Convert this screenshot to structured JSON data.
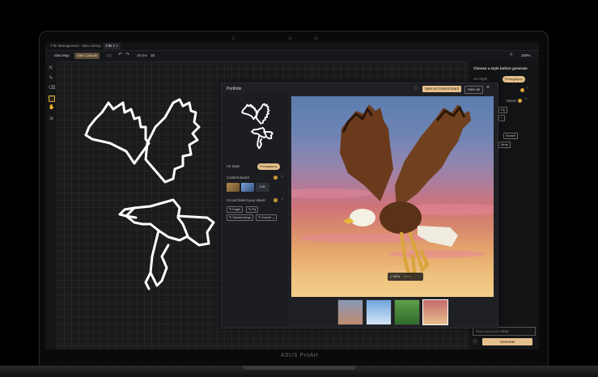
{
  "tabs": [
    "File Management",
    "Idea Library",
    "File 1"
  ],
  "tab_close": "×",
  "toolbar": {
    "idea_map": "Idea Map",
    "idea_canvas": "Idea Canvas",
    "stroke_label": "Stroke",
    "stroke_value": "10",
    "zoom": "100%"
  },
  "right_panel": {
    "title": "Choose a style before generate",
    "art_style_label": "Art Style",
    "art_style_value": "Photography",
    "chips": [
      "Fly",
      "Sunset",
      "Birds"
    ],
    "placeholder": "Keep input your ideas",
    "generate": "Generate",
    "frag_1": "Ideas!"
  },
  "dialog": {
    "title": "Portfolio",
    "save_board": "Save to Content board",
    "save_as": "Save as",
    "art_style_label": "Art Style",
    "art_style_value": "Photography",
    "content_board_label": "Content Board",
    "content_board_count": "2",
    "edit_label": "Edit",
    "ai_label": "AI can Detect your ideas!",
    "ai_count": "4",
    "tags": [
      "Eagle",
      "Fly",
      "Spread wings",
      "Sunset"
    ],
    "zoom_value": "80%"
  },
  "brand": "ASUS ProArt",
  "colors": {
    "accent": "#e6c08c",
    "badge": "#d9a53a"
  }
}
